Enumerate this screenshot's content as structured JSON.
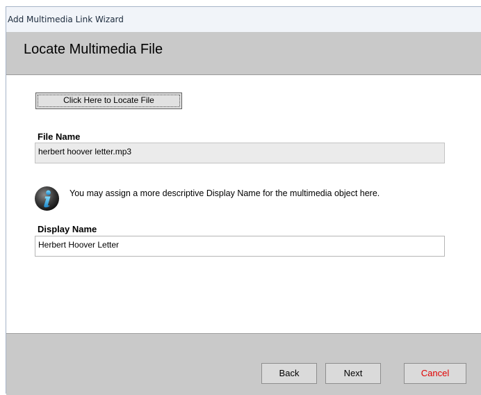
{
  "window": {
    "title": "Add Multimedia Link Wizard"
  },
  "header": {
    "title": "Locate Multimedia File"
  },
  "locate_button": {
    "label": "Click Here to Locate File"
  },
  "file_name": {
    "label": "File Name",
    "value": "herbert hoover letter.mp3"
  },
  "info": {
    "icon": "info-icon",
    "text": "You may assign a more descriptive Display Name for the multimedia object here."
  },
  "display_name": {
    "label": "Display Name",
    "value": "Herbert Hoover Letter"
  },
  "footer": {
    "back_label": "Back",
    "next_label": "Next",
    "cancel_label": "Cancel",
    "cancel_color": "#e00000"
  }
}
